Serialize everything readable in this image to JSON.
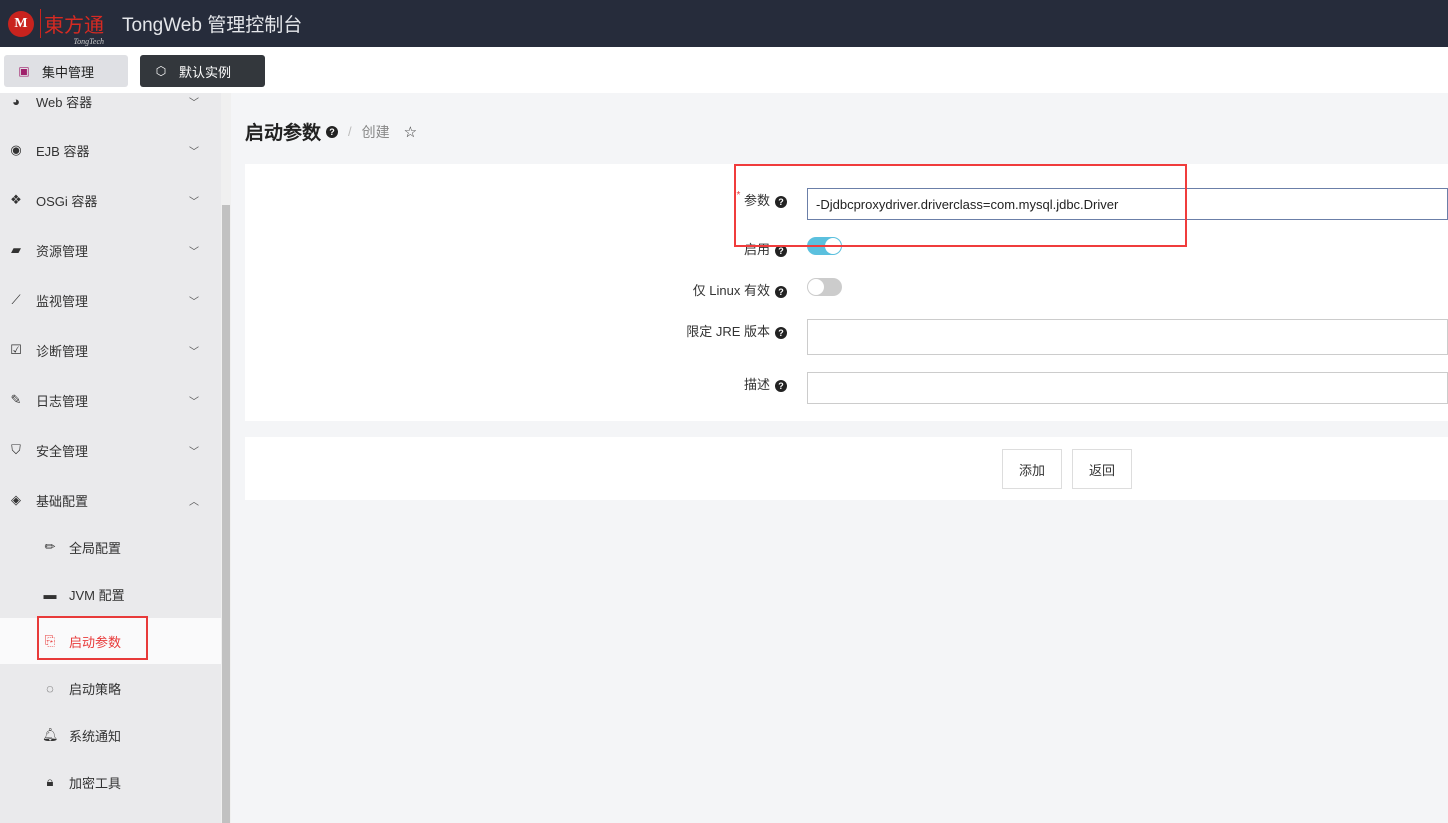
{
  "header": {
    "logo_text": "東方通",
    "logo_sub": "TongTech",
    "logo_mark": "M",
    "title": "TongWeb 管理控制台"
  },
  "toolbar": {
    "central": "集中管理",
    "instance": "默认实例"
  },
  "sidebar": {
    "items": [
      {
        "label": "Web 容器",
        "icon": "globe-icon"
      },
      {
        "label": "EJB 容器",
        "icon": "target-icon"
      },
      {
        "label": "OSGi 容器",
        "icon": "cubes-icon"
      },
      {
        "label": "资源管理",
        "icon": "book-icon"
      },
      {
        "label": "监视管理",
        "icon": "chart-line-icon"
      },
      {
        "label": "诊断管理",
        "icon": "clipboard-check-icon"
      },
      {
        "label": "日志管理",
        "icon": "edit-icon"
      },
      {
        "label": "安全管理",
        "icon": "shield-icon"
      },
      {
        "label": "基础配置",
        "icon": "layers-icon"
      }
    ],
    "subitems": [
      {
        "label": "全局配置",
        "icon": "pencil-icon"
      },
      {
        "label": "JVM 配置",
        "icon": "coffee-icon"
      },
      {
        "label": "启动参数",
        "icon": "code-file-icon"
      },
      {
        "label": "启动策略",
        "icon": "spinner-icon"
      },
      {
        "label": "系统通知",
        "icon": "bell-icon"
      },
      {
        "label": "加密工具",
        "icon": "lock-icon"
      }
    ]
  },
  "breadcrumb": {
    "title": "启动参数",
    "current": "创建",
    "separator": "/"
  },
  "form": {
    "param_label": "参数",
    "param_value": "-Djdbcproxydriver.driverclass=com.mysql.jdbc.Driver",
    "enable_label": "启用",
    "enable_on": true,
    "linux_label": "仅 Linux 有效",
    "linux_on": false,
    "jre_label": "限定 JRE 版本",
    "jre_value": "",
    "desc_label": "描述",
    "desc_value": ""
  },
  "actions": {
    "add": "添加",
    "back": "返回"
  },
  "colors": {
    "accent": "#5bc0de",
    "highlight": "#f03c3c",
    "header": "#262c3b"
  }
}
